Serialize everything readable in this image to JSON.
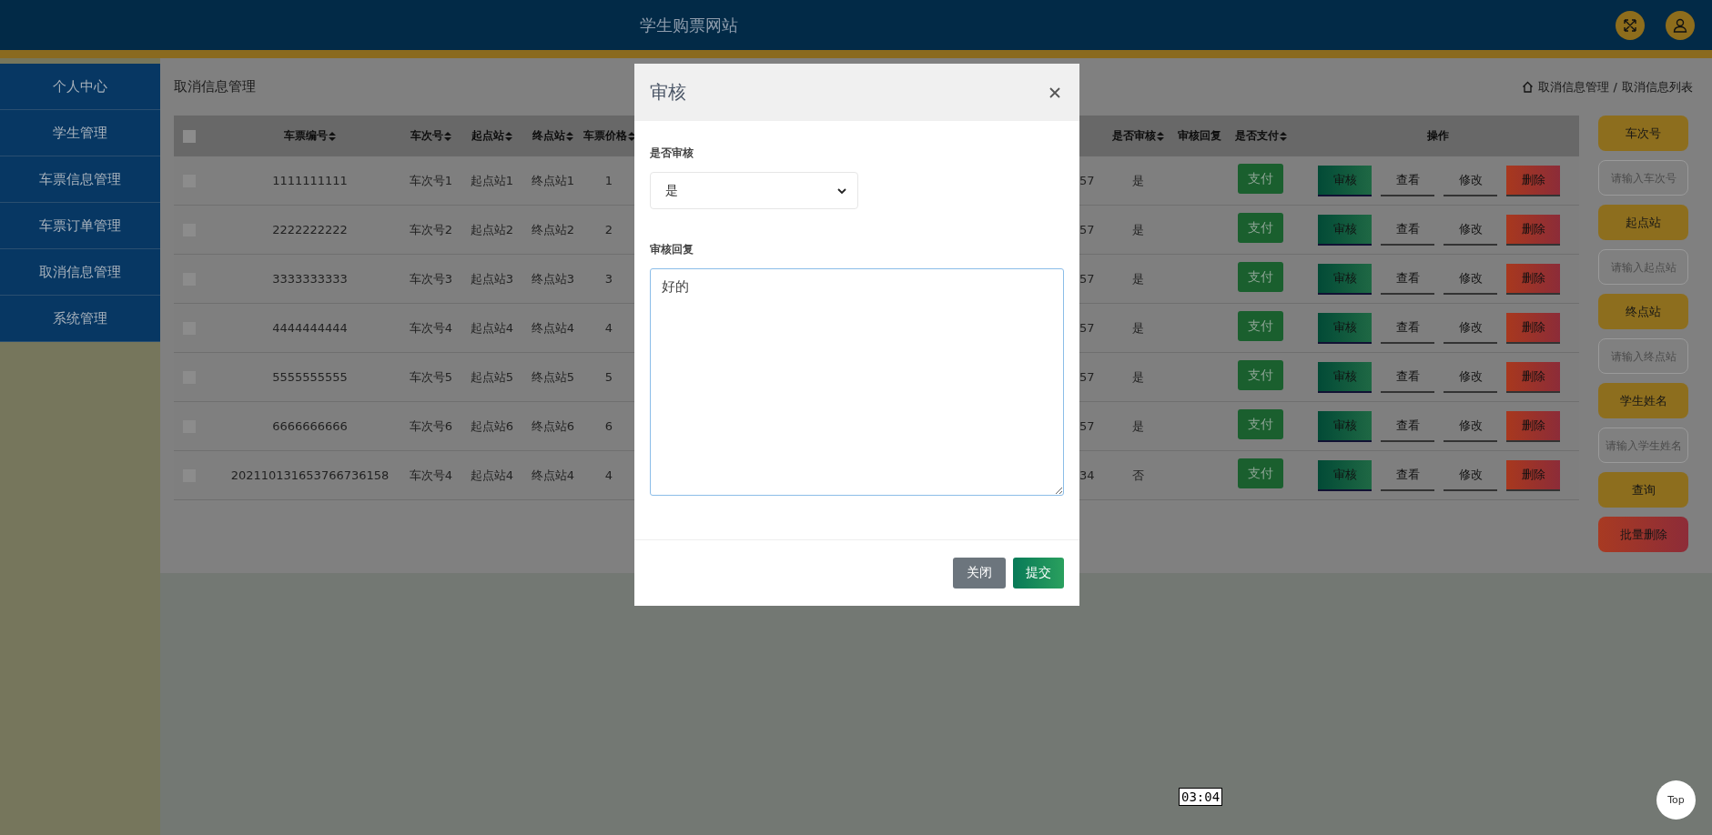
{
  "header": {
    "title": "学生购票网站"
  },
  "sidebar": {
    "items": [
      {
        "label": "个人中心"
      },
      {
        "label": "学生管理"
      },
      {
        "label": "车票信息管理"
      },
      {
        "label": "车票订单管理"
      },
      {
        "label": "取消信息管理"
      },
      {
        "label": "系统管理"
      }
    ]
  },
  "page": {
    "title": "取消信息管理",
    "breadcrumb": {
      "items": [
        "取消信息管理",
        "取消信息列表"
      ],
      "separator": "/"
    }
  },
  "table": {
    "select_all": false,
    "columns": [
      {
        "kind": "text",
        "label": "车票编号",
        "sortable": true
      },
      {
        "kind": "text",
        "label": "车次号",
        "sortable": true
      },
      {
        "kind": "text",
        "label": "起点站",
        "sortable": true
      },
      {
        "kind": "text",
        "label": "终点站",
        "sortable": true
      },
      {
        "kind": "text",
        "label": "车票价格",
        "sortable": true
      },
      {
        "kind": "cut"
      },
      {
        "kind": "text",
        "label": "是否审核",
        "sortable": true
      },
      {
        "kind": "reply",
        "label": "审核回复",
        "sortable": false
      },
      {
        "kind": "pay",
        "label": "是否支付",
        "sortable": true
      },
      {
        "kind": "actions",
        "label": "操作",
        "sortable": false
      }
    ],
    "rows": [
      {
        "selected": false,
        "cells": [
          "1111111111",
          "车次号1",
          "起点站1",
          "终点站1",
          "1",
          "57",
          "是"
        ],
        "pay": "支付",
        "actions": [
          {
            "label": "审核",
            "kind": "review"
          },
          {
            "label": "查看",
            "kind": "link"
          },
          {
            "label": "修改",
            "kind": "link"
          },
          {
            "label": "删除",
            "kind": "danger"
          }
        ]
      },
      {
        "selected": false,
        "cells": [
          "2222222222",
          "车次号2",
          "起点站2",
          "终点站2",
          "2",
          "57",
          "是"
        ],
        "pay": "支付",
        "actions": [
          {
            "label": "审核",
            "kind": "review"
          },
          {
            "label": "查看",
            "kind": "link"
          },
          {
            "label": "修改",
            "kind": "link"
          },
          {
            "label": "删除",
            "kind": "danger"
          }
        ]
      },
      {
        "selected": false,
        "cells": [
          "3333333333",
          "车次号3",
          "起点站3",
          "终点站3",
          "3",
          "57",
          "是"
        ],
        "pay": "支付",
        "actions": [
          {
            "label": "审核",
            "kind": "review"
          },
          {
            "label": "查看",
            "kind": "link"
          },
          {
            "label": "修改",
            "kind": "link"
          },
          {
            "label": "删除",
            "kind": "danger"
          }
        ]
      },
      {
        "selected": false,
        "cells": [
          "4444444444",
          "车次号4",
          "起点站4",
          "终点站4",
          "4",
          "57",
          "是"
        ],
        "pay": "支付",
        "actions": [
          {
            "label": "审核",
            "kind": "review"
          },
          {
            "label": "查看",
            "kind": "link"
          },
          {
            "label": "修改",
            "kind": "link"
          },
          {
            "label": "删除",
            "kind": "danger"
          }
        ]
      },
      {
        "selected": false,
        "cells": [
          "5555555555",
          "车次号5",
          "起点站5",
          "终点站5",
          "5",
          "57",
          "是"
        ],
        "pay": "支付",
        "actions": [
          {
            "label": "审核",
            "kind": "review"
          },
          {
            "label": "查看",
            "kind": "link"
          },
          {
            "label": "修改",
            "kind": "link"
          },
          {
            "label": "删除",
            "kind": "danger"
          }
        ]
      },
      {
        "selected": false,
        "cells": [
          "6666666666",
          "车次号6",
          "起点站6",
          "终点站6",
          "6",
          "57",
          "是"
        ],
        "pay": "支付",
        "actions": [
          {
            "label": "审核",
            "kind": "review"
          },
          {
            "label": "查看",
            "kind": "link"
          },
          {
            "label": "修改",
            "kind": "link"
          },
          {
            "label": "删除",
            "kind": "danger"
          }
        ]
      },
      {
        "selected": false,
        "cells": [
          "202110131653766736158",
          "车次号4",
          "起点站4",
          "终点站4",
          "4",
          "34",
          "否"
        ],
        "pay": "支付",
        "actions": [
          {
            "label": "审核",
            "kind": "review"
          },
          {
            "label": "查看",
            "kind": "link"
          },
          {
            "label": "修改",
            "kind": "link"
          },
          {
            "label": "删除",
            "kind": "danger"
          }
        ]
      }
    ]
  },
  "search_panel": {
    "filters": [
      {
        "label": "车次号",
        "placeholder": "请输入车次号"
      },
      {
        "label": "起点站",
        "placeholder": "请输入起点站"
      },
      {
        "label": "终点站",
        "placeholder": "请输入终点站"
      },
      {
        "label": "学生姓名",
        "placeholder": "请输入学生姓名"
      }
    ],
    "buttons": [
      {
        "label": "查询",
        "kind": "search"
      },
      {
        "label": "批量删除",
        "kind": "danger"
      }
    ]
  },
  "modal": {
    "title": "审核",
    "fields": [
      {
        "kind": "select",
        "label": "是否审核",
        "value": "是"
      },
      {
        "kind": "textarea",
        "label": "审核回复",
        "value": "好的"
      }
    ],
    "buttons": [
      {
        "label": "关闭",
        "kind": "secondary"
      },
      {
        "label": "提交",
        "kind": "primary"
      }
    ]
  },
  "video_time_tooltip": "03:04",
  "back_to_top": "Top"
}
